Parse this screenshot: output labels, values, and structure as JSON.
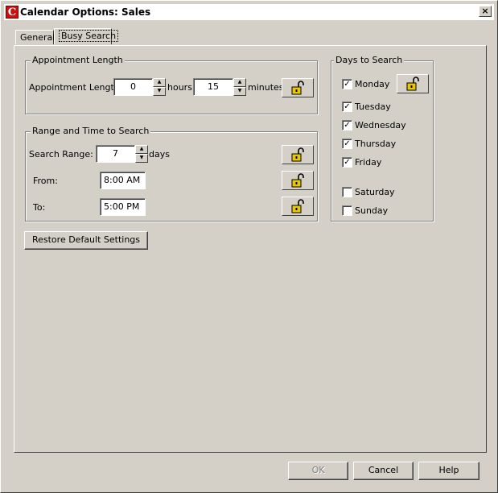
{
  "window": {
    "title": "Calendar Options:  Sales",
    "app_icon_letter": "C",
    "close_glyph": "×"
  },
  "tabs": [
    {
      "label": "General",
      "active": false
    },
    {
      "label": "Busy Search",
      "active": true
    }
  ],
  "appointment_length": {
    "group_title": "Appointment Length",
    "label": "Appointment Length",
    "hours_value": "0",
    "hours_label": "hours",
    "minutes_value": "15",
    "minutes_label": "minutes",
    "lock_icon": "unlocked-padlock-icon"
  },
  "range": {
    "group_title": "Range and Time to Search",
    "search_range_label": "Search Range:",
    "search_range_value": "7",
    "days_label": "days",
    "from_label": "From:",
    "from_value": "8:00 AM",
    "to_label": "To:",
    "to_value": "5:00 PM"
  },
  "days": {
    "group_title": "Days to Search",
    "items": [
      {
        "label": "Monday",
        "checked": true
      },
      {
        "label": "Tuesday",
        "checked": true
      },
      {
        "label": "Wednesday",
        "checked": true
      },
      {
        "label": "Thursday",
        "checked": true
      },
      {
        "label": "Friday",
        "checked": true
      },
      {
        "label": "Saturday",
        "checked": false
      },
      {
        "label": "Sunday",
        "checked": false
      }
    ]
  },
  "restore_label": "Restore Default Settings",
  "footer": {
    "ok_label": "OK",
    "ok_disabled": true,
    "cancel_label": "Cancel",
    "help_label": "Help"
  },
  "colors": {
    "face": "#d4d0c8",
    "lock_yellow": "#e8c800",
    "icon_red": "#cc1010"
  }
}
